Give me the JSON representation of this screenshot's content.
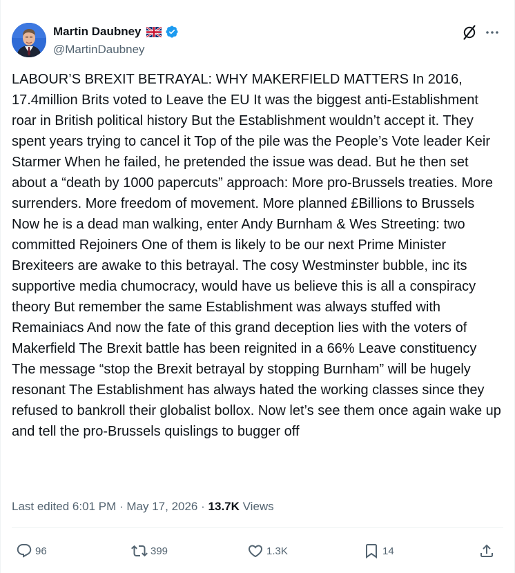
{
  "author": {
    "display_name": "Martin Daubney",
    "handle": "@MartinDaubney",
    "flag_icon": "uk-flag-icon",
    "verified_icon": "verified-badge-icon"
  },
  "header_actions": {
    "grok_icon": "grok-icon",
    "more_icon": "more-icon"
  },
  "tweet": {
    "text": "LABOUR’S BREXIT BETRAYAL: WHY MAKERFIELD MATTERS In 2016, 17.4million Brits voted to Leave the EU It was the biggest anti-Establishment roar in British political history But the Establishment wouldn’t accept it. They spent years trying to cancel it Top of the pile was the People’s Vote leader Keir Starmer  When he failed, he pretended the issue was dead. But he then set about a “death by 1000 papercuts” approach: More pro-Brussels treaties. More surrenders. More freedom of movement. More planned £Billions to Brussels  Now he is a dead man walking, enter Andy Burnham & Wes Streeting: two committed Rejoiners  One of them is likely to be our next Prime Minister  Brexiteers are awake to this betrayal. The cosy Westminster bubble, inc its supportive media chumocracy, would have us believe this is all a conspiracy theory  But remember the same Establishment was always stuffed with Remainiacs  And now the fate of this grand deception lies with the voters of Makerfield  The Brexit battle has been reignited in a 66% Leave constituency  The message “stop the Brexit betrayal by stopping Burnham” will be hugely resonant  The Establishment has always hated the working classes since they refused to bankroll their globalist bollox.  Now let’s see them once again wake up and tell the pro-Brussels quislings to bugger off"
  },
  "meta": {
    "edited_prefix": "Last edited",
    "time": "6:01 PM",
    "separator1": "·",
    "date": "May 17, 2026",
    "separator2": "·",
    "views_count": "13.7K",
    "views_label": "Views"
  },
  "actions": {
    "reply": {
      "icon": "reply-icon",
      "count": "96"
    },
    "repost": {
      "icon": "repost-icon",
      "count": "399"
    },
    "like": {
      "icon": "heart-icon",
      "count": "1.3K"
    },
    "bookmark": {
      "icon": "bookmark-icon",
      "count": "14"
    },
    "share": {
      "icon": "share-icon"
    }
  },
  "colors": {
    "text_primary": "#0f1419",
    "text_secondary": "#536471",
    "divider": "#eff3f4",
    "verified_blue": "#1d9bf0",
    "avatar_background": "#2b61c8"
  }
}
